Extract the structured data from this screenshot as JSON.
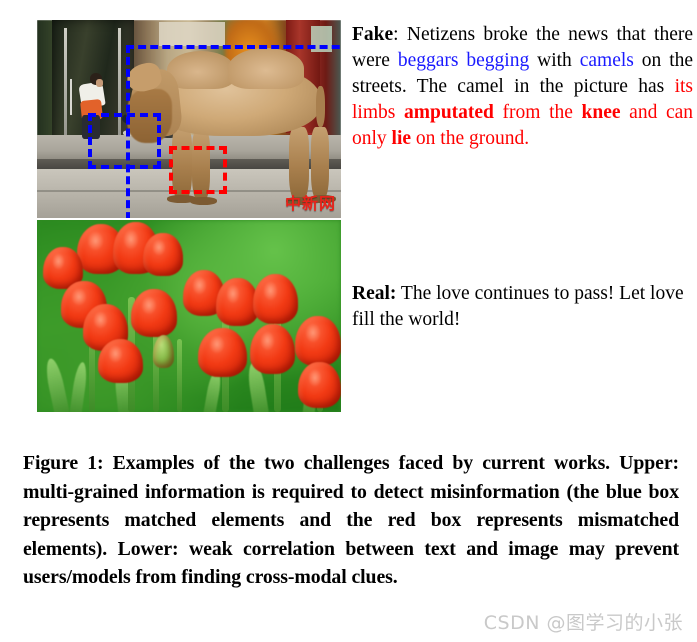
{
  "figure": {
    "camel_image": {
      "alt_description": "Camel standing on a city sidewalk in front of a storefront with two people near the door",
      "watermark": "中新网",
      "annotations": [
        {
          "name": "blue-box-large",
          "color": "#0000FF",
          "style": "dashed",
          "meaning": "matched elements"
        },
        {
          "name": "blue-box-people",
          "color": "#0000FF",
          "style": "dashed",
          "meaning": "matched elements"
        },
        {
          "name": "red-box-knee",
          "color": "#FF0000",
          "style": "dashed",
          "meaning": "mismatched elements"
        }
      ]
    },
    "tulip_image": {
      "alt_description": "Close-up of red tulips against a blurred green background"
    }
  },
  "fake_caption": {
    "label": "Fake",
    "label_suffix": ":",
    "segment_1": " Netizens broke the news that there were ",
    "blue_1": "beggars begging",
    "segment_2": " with ",
    "blue_2": "camels",
    "segment_3": " on the streets. The camel in the picture has ",
    "red_1": "its limbs ",
    "red_bold_1": "amputated",
    "red_2": " from the ",
    "red_bold_2": "knee",
    "red_3": " and can only ",
    "red_bold_3": "lie",
    "red_4": " on the ground."
  },
  "real_caption": {
    "label": "Real:",
    "text": " The love continues to pass! Let love fill the world!"
  },
  "figure_caption": {
    "text": "Figure 1: Examples of the two challenges faced by current works. Upper: multi-grained information is required to detect misinformation (the blue box represents matched elements and the red box represents mismatched elements). Lower: weak correlation between text and image may prevent users/models from finding cross-modal clues."
  },
  "watermark": {
    "text": "CSDN @图学习的小张",
    "color": "#C9C9C9"
  },
  "colors": {
    "matched_box": "#0000FF",
    "mismatched_box": "#FF0000",
    "fake_highlight_blue": "#1A1AFF",
    "fake_highlight_red": "#FF0000",
    "page_background": "#FFFFFF",
    "text": "#000000"
  }
}
